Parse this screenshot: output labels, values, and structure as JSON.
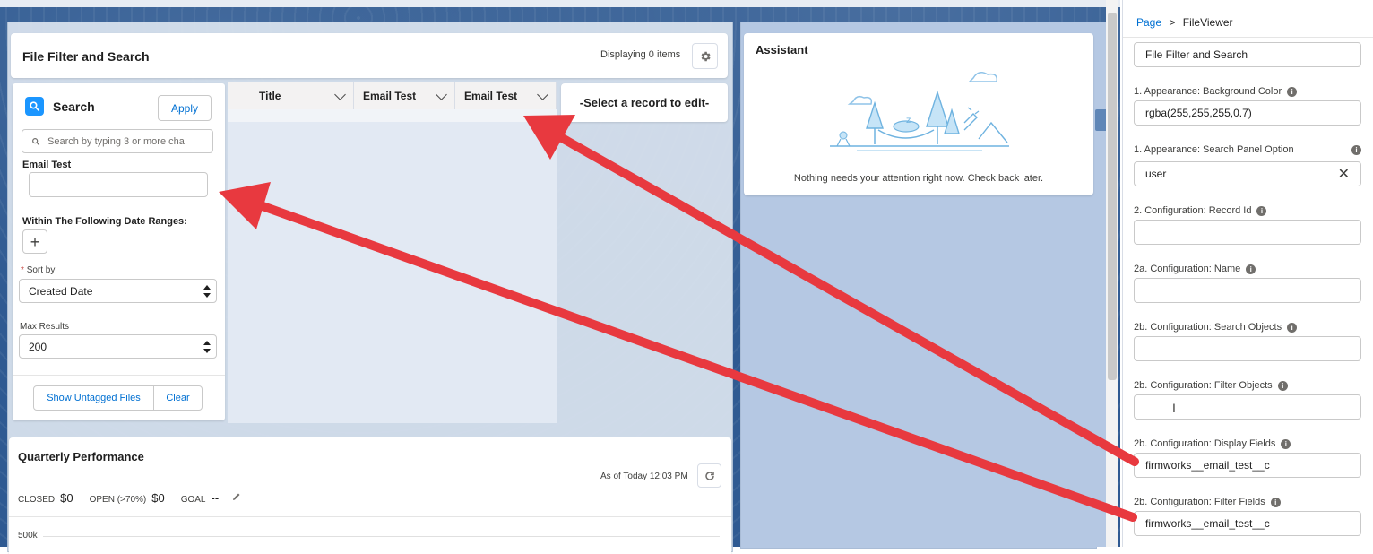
{
  "filter_card": {
    "title": "File Filter and Search",
    "displaying": "Displaying 0 items",
    "search_title": "Search",
    "apply": "Apply",
    "search_placeholder": "Search by typing 3 or more cha",
    "email_label": "Email Test",
    "date_ranges_label": "Within The Following Date Ranges:",
    "sort_required": "*",
    "sort_label": "Sort by",
    "sort_value": "Created Date",
    "max_label": "Max Results",
    "max_value": "200",
    "show_untagged": "Show Untagged Files",
    "clear": "Clear",
    "table_headers": [
      "Title",
      "Email Test",
      "Email Test"
    ],
    "select_record": "-Select a record to edit-",
    "icons": {
      "settings": "gear-icon",
      "search": "search-icon",
      "add": "plus-icon",
      "chevron": "chevron-down-icon"
    }
  },
  "assistant": {
    "title": "Assistant",
    "message": "Nothing needs your attention right now. Check back later."
  },
  "quarterly": {
    "title": "Quarterly Performance",
    "as_of": "As of Today 12:03 PM",
    "closed_label": "CLOSED",
    "closed_value": "$0",
    "open_label": "OPEN (>70%)",
    "open_value": "$0",
    "goal_label": "GOAL",
    "goal_value": "--",
    "y_tick": "500k"
  },
  "panel": {
    "breadcrumb_page": "Page",
    "breadcrumb_sep": ">",
    "breadcrumb_current": "FileViewer",
    "title_value": "File Filter and Search",
    "fields": [
      {
        "label": "1. Appearance: Background Color",
        "value": "rgba(255,255,255,0.7)"
      },
      {
        "label": "1. Appearance: Search Panel Option",
        "value": "user"
      },
      {
        "label": "2. Configuration: Record Id",
        "value": ""
      },
      {
        "label": "2a. Configuration: Name",
        "value": ""
      },
      {
        "label": "2b. Configuration: Search Objects",
        "value": ""
      },
      {
        "label": "2b. Configuration: Filter Objects",
        "value": ""
      },
      {
        "label": "2b. Configuration: Display Fields",
        "value": "firmworks__email_test__c"
      },
      {
        "label": "2b. Configuration: Filter Fields",
        "value": "firmworks__email_test__c"
      }
    ]
  },
  "colors": {
    "brand_blue": "#0070d2",
    "canvas": "#2f5a92",
    "arrow_red": "#e8393f"
  }
}
